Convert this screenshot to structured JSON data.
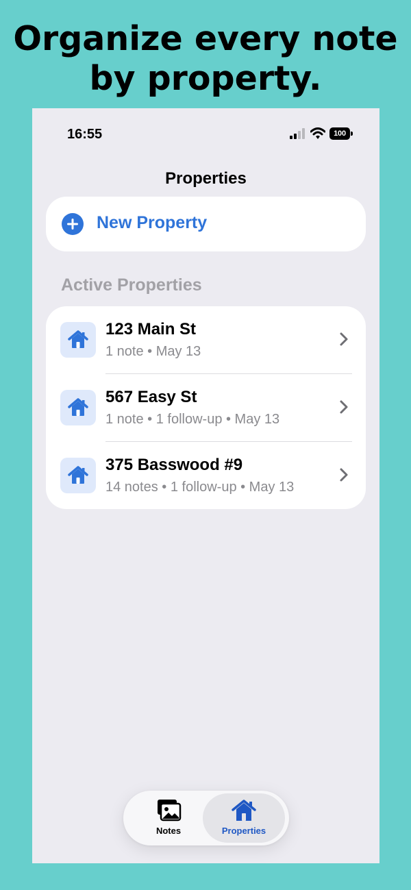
{
  "headline": {
    "line1": "Organize every note",
    "line2": "by property."
  },
  "status_bar": {
    "time": "16:55",
    "battery": "100"
  },
  "nav": {
    "title": "Properties"
  },
  "new_property": {
    "label": "New Property",
    "icon": "plus-circle-icon"
  },
  "section": {
    "header": "Active Properties"
  },
  "properties": [
    {
      "title": "123 Main St",
      "meta": "1 note • May 13",
      "icon": "house-icon"
    },
    {
      "title": "567 Easy St",
      "meta": "1 note • 1 follow-up • May 13",
      "icon": "house-icon"
    },
    {
      "title": "375 Basswood #9",
      "meta": "14 notes • 1 follow-up • May 13",
      "icon": "house-icon"
    }
  ],
  "tab_bar": {
    "tabs": [
      {
        "label": "Notes",
        "icon": "photos-icon",
        "active": false
      },
      {
        "label": "Properties",
        "icon": "house-icon",
        "active": true
      }
    ]
  },
  "colors": {
    "background": "#67cfcc",
    "screen": "#ecebf1",
    "accent": "#2f74d9",
    "active_tab": "#1f58c4",
    "secondary_text": "#8a8a8e"
  }
}
